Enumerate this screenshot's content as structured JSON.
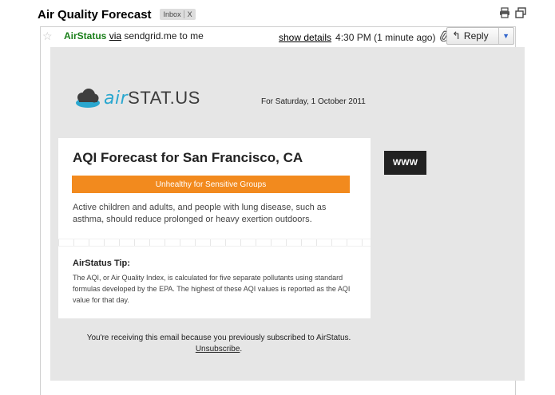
{
  "subject": {
    "title": "Air Quality Forecast",
    "label": "Inbox",
    "label_close": "X"
  },
  "toolbar": {
    "print_icon": "print-icon",
    "newwindow_icon": "new-window-icon"
  },
  "message": {
    "sender_name": "AirStatus",
    "via_text": "via",
    "via_domain": "sendgrid.me",
    "to_text": "to me",
    "show_details": "show details",
    "time": "4:30 PM (1 minute ago)",
    "reply_label": "Reply"
  },
  "email": {
    "logo_air": "air",
    "logo_stat": "STAT.US",
    "forecast_date": "For Saturday, 1 October 2011",
    "card_title": "AQI Forecast for San Francisco, CA",
    "aqi_category": "Unhealthy for Sensitive Groups",
    "aqi_description": "Active children and adults, and people with lung disease, such as asthma, should reduce prolonged or heavy exertion outdoors.",
    "tip_title": "AirStatus Tip:",
    "tip_text": "The AQI, or Air Quality Index, is calculated for five separate pollutants using standard formulas developed by the EPA. The highest of these AQI values is reported as the AQI value for that day.",
    "www_label": "WWW",
    "footer_text": "You're receiving this email because you previously subscribed to AirStatus.",
    "unsubscribe": "Unsubscribe"
  },
  "colors": {
    "aqi_orange": "#f28a1e",
    "sender_green": "#1a7f1a",
    "logo_blue": "#2aa7cf"
  }
}
